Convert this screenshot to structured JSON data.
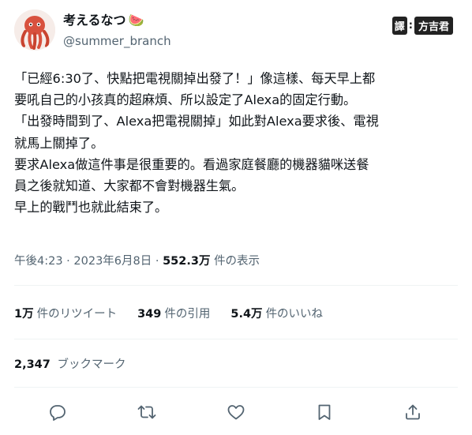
{
  "user": {
    "display_name": "考えるなつ",
    "name_emoji": "🍉",
    "handle": "@summer_branch"
  },
  "badge": {
    "part1": "譯",
    "part2": "方吉君"
  },
  "tweet": {
    "lines": [
      "「已經6:30了、快點把電視關掉出發了！」像這樣、每天早上都",
      "要吼自己的小孩真的超麻煩、所以設定了Alexa的固定行動。",
      "「出發時間到了、Alexa把電視關掉」如此對Alexa要求後、電視",
      "就馬上關掉了。",
      "要求Alexa做這件事是很重要的。看過家庭餐廳的機器貓咪送餐",
      "員之後就知道、大家都不會對機器生氣。",
      "早上的戰鬥也就此結束了。"
    ]
  },
  "meta": {
    "time": "午後4:23",
    "sep": "·",
    "date": "2023年6月8日",
    "views": "552.3万",
    "views_label": "件の表示"
  },
  "stats": {
    "retweets": {
      "count": "1万",
      "label": "件のリツイート"
    },
    "quotes": {
      "count": "349",
      "label": "件の引用"
    },
    "likes": {
      "count": "5.4万",
      "label": "件のいいね"
    }
  },
  "bookmarks": {
    "count": "2,347",
    "label": "ブックマーク"
  },
  "icons": [
    "reply-icon",
    "retweet-icon",
    "like-icon",
    "bookmark-icon",
    "share-icon"
  ]
}
